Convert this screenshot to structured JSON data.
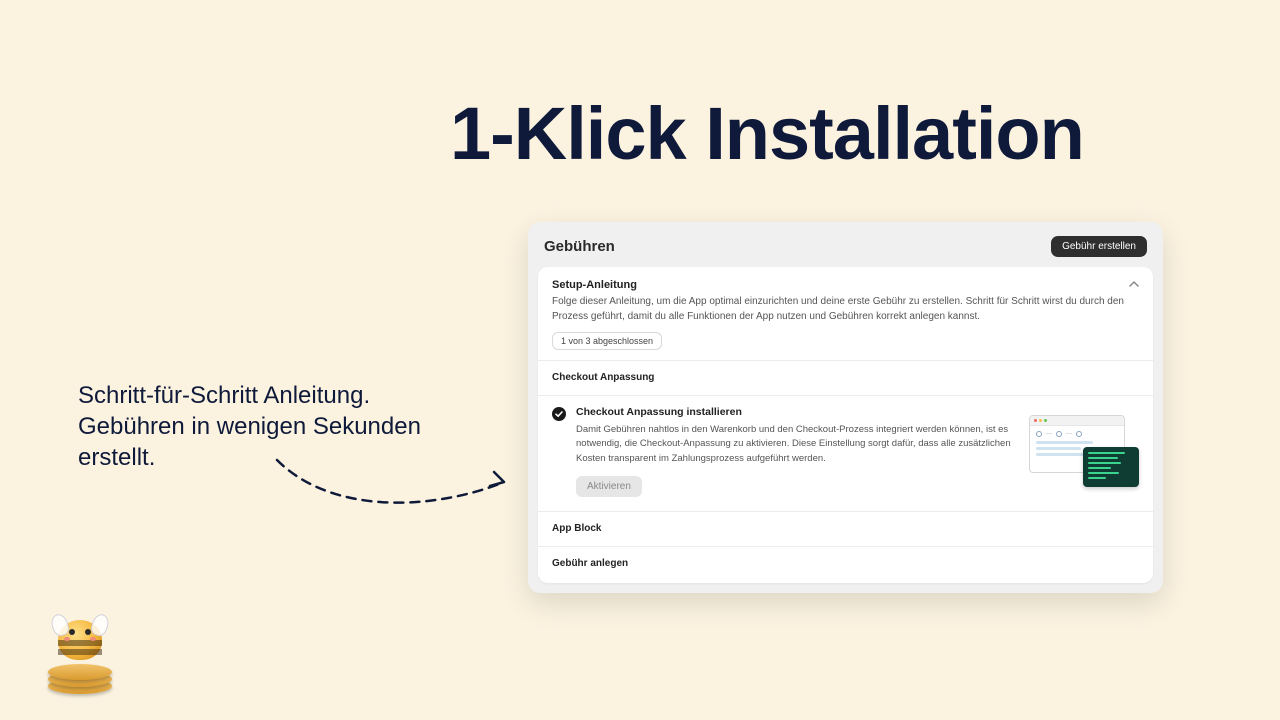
{
  "headline": "1-Klick Installation",
  "subtext": "Schritt-für-Schritt Anleitung. Gebühren in wenigen Sekunden erstellt.",
  "card": {
    "title": "Gebühren",
    "create_button": "Gebühr erstellen",
    "guide": {
      "title": "Setup-Anleitung",
      "description": "Folge dieser Anleitung, um die App optimal einzurichten und deine erste Gebühr zu erstellen. Schritt für Schritt wirst du durch den Prozess geführt, damit du alle Funktionen der App nutzen und Gebühren korrekt anlegen kannst.",
      "progress": "1 von 3 abgeschlossen",
      "sections": [
        {
          "label": "Checkout Anpassung",
          "step": {
            "status": "done",
            "title": "Checkout Anpassung installieren",
            "description": "Damit Gebühren nahtlos in den Warenkorb und den Checkout-Prozess integriert werden können, ist es notwendig, die Checkout-Anpassung zu aktivieren. Diese Einstellung sorgt dafür, dass alle zusätzlichen Kosten transparent im Zahlungsprozess aufgeführt werden.",
            "button": "Aktivieren"
          }
        },
        {
          "label": "App Block"
        },
        {
          "label": "Gebühr anlegen"
        }
      ]
    }
  },
  "colors": {
    "bg": "#fbf3e0",
    "navy": "#0f1a3a"
  }
}
